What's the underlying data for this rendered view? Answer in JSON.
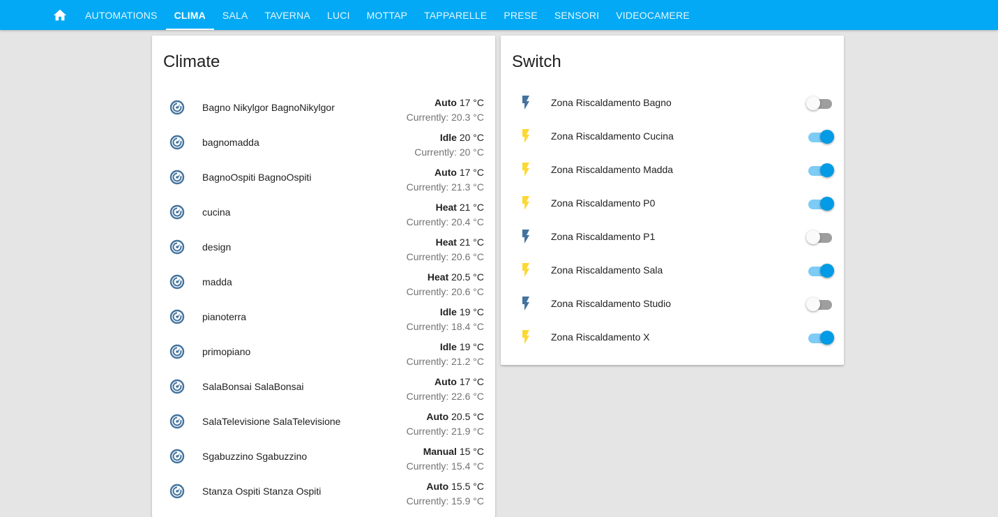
{
  "toolbar": {
    "home_icon": "home-icon",
    "tabs": [
      {
        "label": "AUTOMATIONS",
        "active": false
      },
      {
        "label": "CLIMA",
        "active": true
      },
      {
        "label": "SALA",
        "active": false
      },
      {
        "label": "TAVERNA",
        "active": false
      },
      {
        "label": "LUCI",
        "active": false
      },
      {
        "label": "MOTTAP",
        "active": false
      },
      {
        "label": "TAPPARELLE",
        "active": false
      },
      {
        "label": "PRESE",
        "active": false
      },
      {
        "label": "SENSORI",
        "active": false
      },
      {
        "label": "VIDEOCAMERE",
        "active": false
      }
    ]
  },
  "colors": {
    "toolbar": "#03a9f4",
    "icon_default": "#44739e",
    "icon_active": "#fdd835",
    "toggle_on": "#039be5"
  },
  "climate": {
    "title": "Climate",
    "icon": "thermostat-icon",
    "items": [
      {
        "name": "Bagno Nikylgor BagnoNikylgor",
        "mode": "Auto",
        "target": "17 °C",
        "current": "Currently: 20.3 °C"
      },
      {
        "name": "bagnomadda",
        "mode": "Idle",
        "target": "20 °C",
        "current": "Currently: 20 °C"
      },
      {
        "name": "BagnoOspiti BagnoOspiti",
        "mode": "Auto",
        "target": "17 °C",
        "current": "Currently: 21.3 °C"
      },
      {
        "name": "cucina",
        "mode": "Heat",
        "target": "21 °C",
        "current": "Currently: 20.4 °C"
      },
      {
        "name": "design",
        "mode": "Heat",
        "target": "21 °C",
        "current": "Currently: 20.6 °C"
      },
      {
        "name": "madda",
        "mode": "Heat",
        "target": "20.5 °C",
        "current": "Currently: 20.6 °C"
      },
      {
        "name": "pianoterra",
        "mode": "Idle",
        "target": "19 °C",
        "current": "Currently: 18.4 °C"
      },
      {
        "name": "primopiano",
        "mode": "Idle",
        "target": "19 °C",
        "current": "Currently: 21.2 °C"
      },
      {
        "name": "SalaBonsai SalaBonsai",
        "mode": "Auto",
        "target": "17 °C",
        "current": "Currently: 22.6 °C"
      },
      {
        "name": "SalaTelevisione SalaTelevisione",
        "mode": "Auto",
        "target": "20.5 °C",
        "current": "Currently: 21.9 °C"
      },
      {
        "name": "Sgabuzzino Sgabuzzino",
        "mode": "Manual",
        "target": "15 °C",
        "current": "Currently: 15.4 °C"
      },
      {
        "name": "Stanza Ospiti Stanza Ospiti",
        "mode": "Auto",
        "target": "15.5 °C",
        "current": "Currently: 15.9 °C"
      }
    ]
  },
  "switches": {
    "title": "Switch",
    "icon": "flash-icon",
    "items": [
      {
        "name": "Zona Riscaldamento Bagno",
        "on": false
      },
      {
        "name": "Zona Riscaldamento Cucina",
        "on": true
      },
      {
        "name": "Zona Riscaldamento Madda",
        "on": true
      },
      {
        "name": "Zona Riscaldamento P0",
        "on": true
      },
      {
        "name": "Zona Riscaldamento P1",
        "on": false
      },
      {
        "name": "Zona Riscaldamento Sala",
        "on": true
      },
      {
        "name": "Zona Riscaldamento Studio",
        "on": false
      },
      {
        "name": "Zona Riscaldamento X",
        "on": true
      }
    ]
  }
}
